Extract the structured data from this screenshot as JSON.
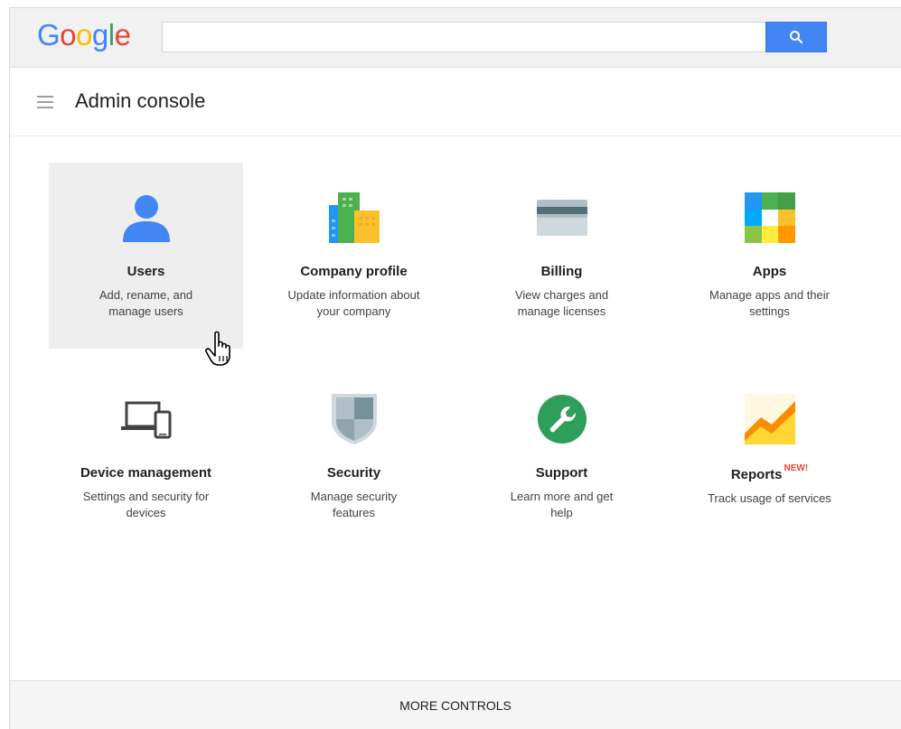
{
  "brand": {
    "logo_letters": [
      "G",
      "o",
      "o",
      "g",
      "l",
      "e"
    ],
    "logo_colors": [
      "#4285f4",
      "#ea4335",
      "#fbbc05",
      "#4285f4",
      "#34a853",
      "#ea4335"
    ]
  },
  "search": {
    "value": "",
    "placeholder": "",
    "icon": "search-icon"
  },
  "header": {
    "title": "Admin console",
    "menu_icon": "hamburger-menu-icon"
  },
  "tiles": [
    {
      "title": "Users",
      "desc": "Add, rename, and manage users",
      "icon": "person-icon"
    },
    {
      "title": "Company profile",
      "desc": "Update information about your company",
      "icon": "buildings-icon"
    },
    {
      "title": "Billing",
      "desc": "View charges and manage licenses",
      "icon": "credit-card-icon"
    },
    {
      "title": "Apps",
      "desc": "Manage apps and their settings",
      "icon": "apps-grid-icon"
    },
    {
      "title": "Device management",
      "desc": "Settings and security for devices",
      "icon": "laptop-phone-icon"
    },
    {
      "title": "Security",
      "desc": "Manage security features",
      "icon": "shield-icon"
    },
    {
      "title": "Support",
      "desc": "Learn more and get help",
      "icon": "wrench-icon"
    },
    {
      "title": "Reports",
      "badge": "NEW!",
      "desc": "Track usage of services",
      "icon": "chart-icon"
    }
  ],
  "footer": {
    "label": "MORE CONTROLS"
  },
  "colors": {
    "accent": "#4285f4",
    "badge": "#f44336",
    "hover_tile": "#eeeeee"
  }
}
